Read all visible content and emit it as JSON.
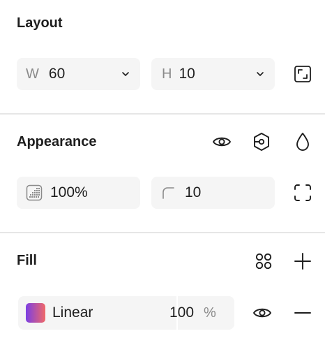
{
  "layout": {
    "title": "Layout",
    "width_prefix": "W",
    "width_value": "60",
    "height_prefix": "H",
    "height_value": "10"
  },
  "appearance": {
    "title": "Appearance",
    "opacity_value": "100%",
    "radius_value": "10"
  },
  "fill": {
    "title": "Fill",
    "type_label": "Linear",
    "opacity_value": "100",
    "opacity_unit": "%",
    "gradient_colors": [
      "#7b3fe4",
      "#f06868"
    ]
  },
  "icons": {
    "resize": "resize-to-fit-icon",
    "visibility": "eye-icon",
    "variable": "variable-hex-icon",
    "blend": "drop-icon",
    "corners": "independent-corners-icon",
    "styles": "styles-grid-icon",
    "add": "plus-icon",
    "remove": "minus-icon"
  }
}
